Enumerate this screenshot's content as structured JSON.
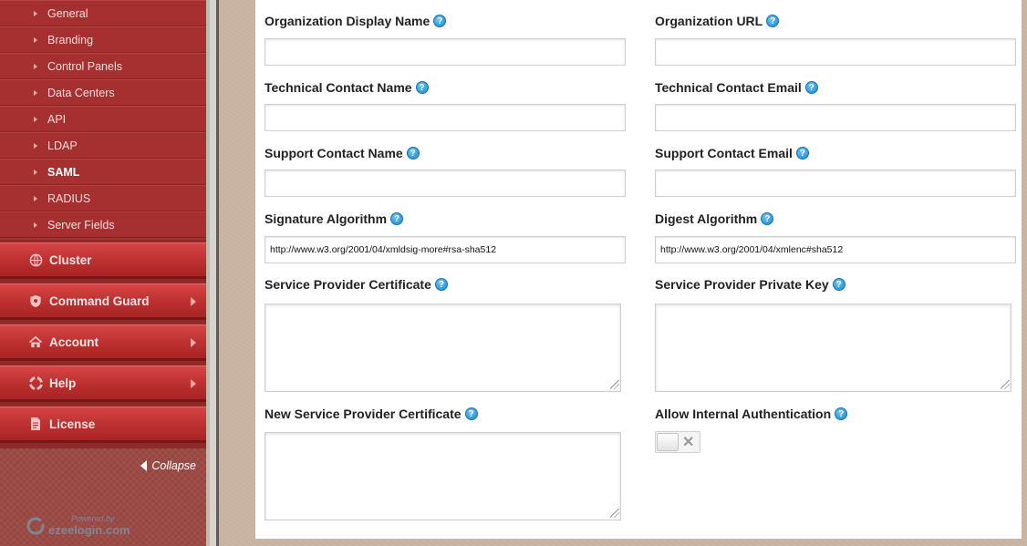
{
  "sidebar": {
    "sub_items": [
      {
        "label": "General",
        "active": false
      },
      {
        "label": "Branding",
        "active": false
      },
      {
        "label": "Control Panels",
        "active": false
      },
      {
        "label": "Data Centers",
        "active": false
      },
      {
        "label": "API",
        "active": false
      },
      {
        "label": "LDAP",
        "active": false
      },
      {
        "label": "SAML",
        "active": true
      },
      {
        "label": "RADIUS",
        "active": false
      },
      {
        "label": "Server Fields",
        "active": false
      }
    ],
    "menu": [
      {
        "label": "Cluster",
        "icon": "globe-icon",
        "has_arrow": false
      },
      {
        "label": "Command Guard",
        "icon": "shield-icon",
        "has_arrow": true
      },
      {
        "label": "Account",
        "icon": "home-icon",
        "has_arrow": true
      },
      {
        "label": "Help",
        "icon": "lifebuoy-icon",
        "has_arrow": true
      },
      {
        "label": "License",
        "icon": "document-icon",
        "has_arrow": false
      }
    ],
    "collapse_label": "Collapse",
    "powered_by": "Powered by",
    "brand": "ezeelogin.com"
  },
  "form": {
    "org_display_name": {
      "label": "Organization Display Name",
      "value": ""
    },
    "org_url": {
      "label": "Organization URL",
      "value": ""
    },
    "tech_contact_name": {
      "label": "Technical Contact Name",
      "value": ""
    },
    "tech_contact_email": {
      "label": "Technical Contact Email",
      "value": ""
    },
    "support_contact_name": {
      "label": "Support Contact Name",
      "value": ""
    },
    "support_contact_email": {
      "label": "Support Contact Email",
      "value": ""
    },
    "signature_algorithm": {
      "label": "Signature Algorithm",
      "value": "http://www.w3.org/2001/04/xmldsig-more#rsa-sha512"
    },
    "digest_algorithm": {
      "label": "Digest Algorithm",
      "value": "http://www.w3.org/2001/04/xmlenc#sha512"
    },
    "sp_certificate": {
      "label": "Service Provider Certificate",
      "value": ""
    },
    "sp_private_key": {
      "label": "Service Provider Private Key",
      "value": ""
    },
    "new_sp_certificate": {
      "label": "New Service Provider Certificate",
      "value": ""
    },
    "allow_internal_auth": {
      "label": "Allow Internal Authentication",
      "enabled": false
    }
  },
  "help_glyph": "?",
  "colors": {
    "sidebar_red": "#b92e2e",
    "help_blue": "#1b86c9"
  }
}
